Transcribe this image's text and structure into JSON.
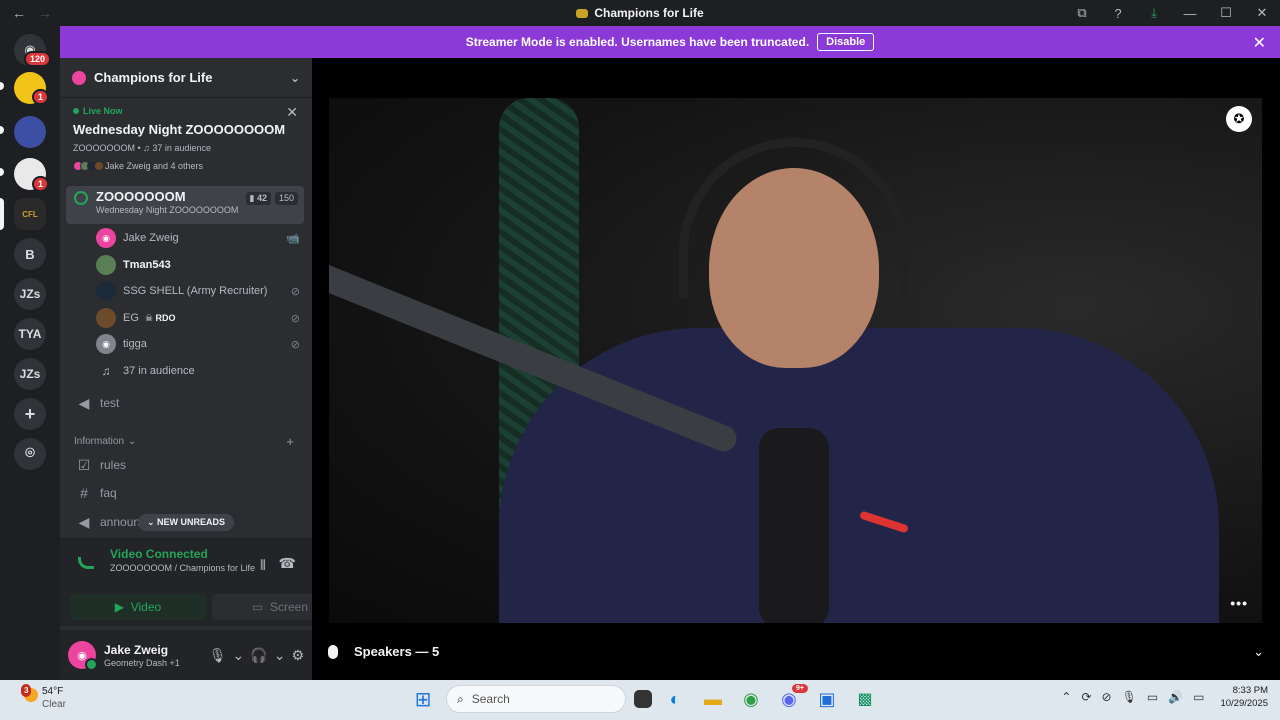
{
  "window": {
    "title": "Champions for Life",
    "nav_back": "←",
    "nav_forward": "→",
    "min": "—",
    "max": "☐",
    "close": "✕",
    "icons": [
      "screen-share-icon",
      "help-icon",
      "download-icon"
    ]
  },
  "banner": {
    "text": "Streamer Mode is enabled. Usernames have been truncated.",
    "disable_label": "Disable",
    "close": "✕"
  },
  "rail": {
    "dm_badge": "120",
    "badges": [
      "1",
      "1"
    ],
    "letters": [
      "B",
      "JZs",
      "TYA",
      "JZs"
    ],
    "add": "+",
    "explore": "⌾"
  },
  "server": {
    "name": "Champions for Life",
    "chevron": "⌄"
  },
  "live": {
    "tag": "Live Now",
    "event_name": "Wednesday Night ZOOOOOOOOM",
    "meta": "ZOOOOOOOM • ♫ 37 in audience",
    "who": "Jake Zweig and 4 others",
    "close": "✕"
  },
  "voice_channel": {
    "name": "ZOOOOOOOM",
    "subtitle": "Wednesday Night ZOOOOOOOOM",
    "video_count": "42",
    "count": "150"
  },
  "members": [
    {
      "name": "Jake Zweig",
      "color": "#eb459f",
      "icon": "📹",
      "bold": false
    },
    {
      "name": "Tman543",
      "color": "#5b7f54",
      "icon": "",
      "bold": true
    },
    {
      "name": "SSG SHELL (Army Recruiter)",
      "color": "#1c2a3a",
      "icon": "⊘",
      "bold": false
    },
    {
      "name": "EG",
      "tag": "☠ RDO",
      "color": "#6b4b2a",
      "icon": "⊘",
      "bold": false
    },
    {
      "name": "tigga",
      "color": "#80848e",
      "icon": "⊘",
      "bold": false
    }
  ],
  "audience": "37 in audience",
  "channels": {
    "test": "test",
    "category": "Information",
    "category_plus": "+",
    "rules": "rules",
    "faq": "faq",
    "announce": "announ",
    "new_unreads": "NEW UNREADS"
  },
  "rtc": {
    "status": "Video Connected",
    "subtitle": "ZOOOOOOOM / Champions for Life",
    "video_label": "Video",
    "screen_label": "Screen"
  },
  "user": {
    "name": "Jake Zweig",
    "status": "Geometry Dash +1"
  },
  "stage": {
    "speakers": "Speakers — 5",
    "more": "•••",
    "pin": "✪",
    "chevron": "⌄"
  },
  "taskbar": {
    "weather_badge": "3",
    "temp": "54°F",
    "condition": "Clear",
    "search_placeholder": "Search",
    "time": "8:33 PM",
    "date": "10/29/2025",
    "discord_badge": "9+"
  },
  "colors": {
    "streamer_banner": "#8b3ad8",
    "connected": "#23a559",
    "rail": "#1e1f22",
    "sidebar": "#2b2d31"
  }
}
